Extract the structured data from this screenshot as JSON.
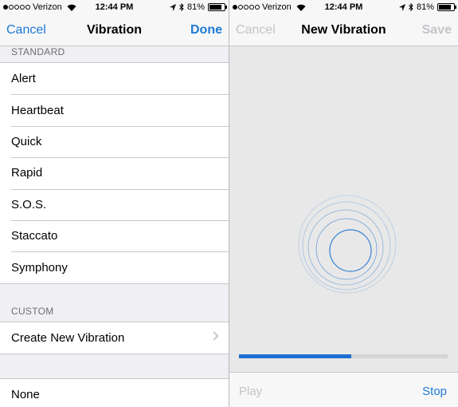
{
  "status_bar": {
    "carrier": "Verizon",
    "time": "12:44 PM",
    "battery": "81%",
    "battery_level": 0.81,
    "signal_bars_filled": 1,
    "signal_bars_total": 5,
    "icons": [
      "wifi-icon",
      "location-arrow-icon",
      "bluetooth-icon",
      "battery-icon"
    ]
  },
  "vibration_screen": {
    "nav": {
      "left": "Cancel",
      "title": "Vibration",
      "right": "Done"
    },
    "standard_header": "STANDARD",
    "standard_items": [
      "Alert",
      "Heartbeat",
      "Quick",
      "Rapid",
      "S.O.S.",
      "Staccato",
      "Symphony"
    ],
    "custom_header": "CUSTOM",
    "custom_item": "Create New Vibration",
    "none_item": "None"
  },
  "new_vibration_screen": {
    "nav": {
      "left": "Cancel",
      "title": "New Vibration",
      "right": "Save"
    },
    "progress": 0.54,
    "play": "Play",
    "stop": "Stop"
  },
  "colors": {
    "accent": "#1e7ad6",
    "disabled": "#c4c4c8",
    "ring": "#2a7bd4",
    "progress": "#1e6fd0"
  }
}
